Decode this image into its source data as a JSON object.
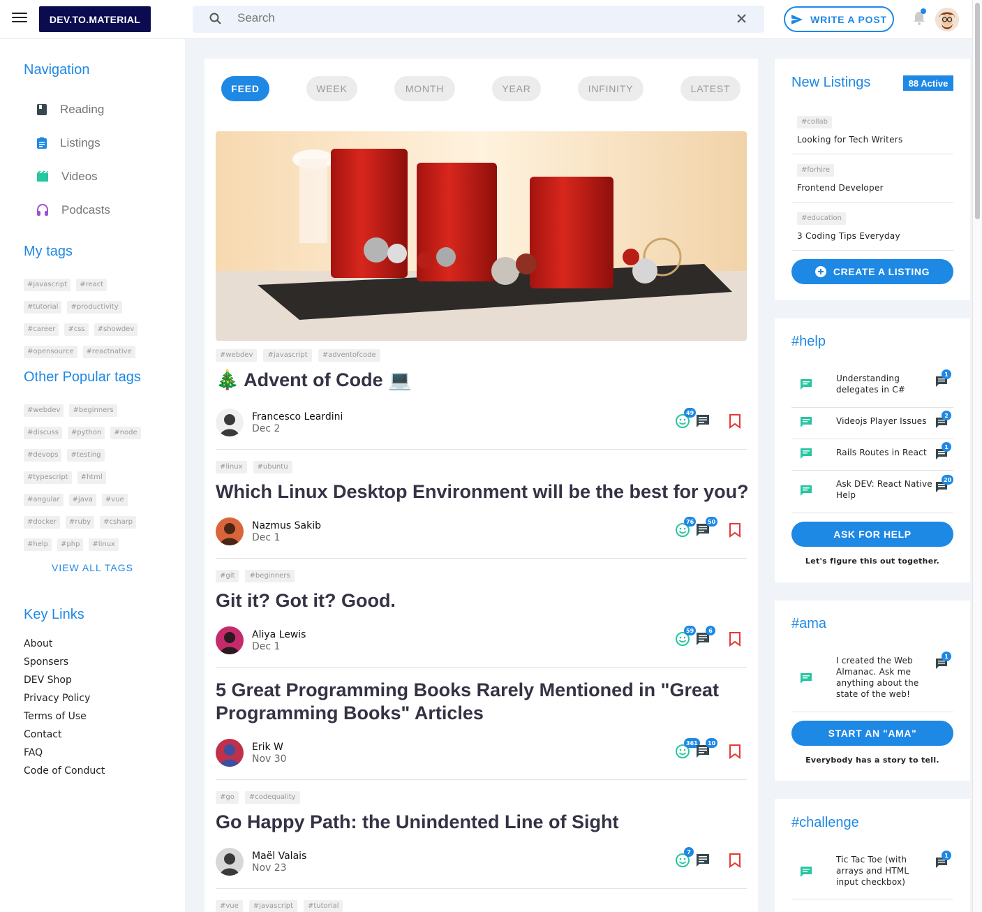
{
  "header": {
    "logo": "DEV.TO.MATERIAL",
    "search_placeholder": "Search",
    "write_label": "WRITE A POST"
  },
  "sidebar": {
    "nav_title": "Navigation",
    "nav_items": [
      {
        "label": "Reading",
        "icon": "book-icon",
        "color": "#37474f"
      },
      {
        "label": "Listings",
        "icon": "clipboard-icon",
        "color": "#1e88e5"
      },
      {
        "label": "Videos",
        "icon": "movie-icon",
        "color": "#26c6a0"
      },
      {
        "label": "Podcasts",
        "icon": "headphones-icon",
        "color": "#9c4fd6"
      }
    ],
    "my_tags_title": "My tags",
    "my_tags": [
      "#javascript",
      "#react",
      "#tutorial",
      "#productivity",
      "#career",
      "#css",
      "#showdev",
      "#opensource",
      "#reactnative"
    ],
    "popular_title": "Other Popular tags",
    "popular_tags": [
      "#webdev",
      "#beginners",
      "#discuss",
      "#python",
      "#node",
      "#devops",
      "#testing",
      "#typescript",
      "#html",
      "#angular",
      "#java",
      "#vue",
      "#docker",
      "#ruby",
      "#csharp",
      "#help",
      "#php",
      "#linux"
    ],
    "view_all": "VIEW ALL TAGS",
    "key_links_title": "Key Links",
    "key_links": [
      "About",
      "Sponsers",
      "DEV Shop",
      "Privacy Policy",
      "Terms of Use",
      "Contact",
      "FAQ",
      "Code of Conduct"
    ]
  },
  "tabs": [
    "FEED",
    "WEEK",
    "MONTH",
    "YEAR",
    "INFINITY",
    "LATEST"
  ],
  "posts": [
    {
      "tags": [
        "#webdev",
        "#javascript",
        "#adventofcode"
      ],
      "title": "🎄 Advent of Code 💻",
      "author": "Francesco Leardini",
      "date": "Dec  2",
      "reactions": "49",
      "comments": ""
    },
    {
      "tags": [
        "#linux",
        "#ubuntu"
      ],
      "title": "Which Linux Desktop Environment will be the best for you?",
      "author": "Nazmus Sakib",
      "date": "Dec  1",
      "reactions": "76",
      "comments": "50"
    },
    {
      "tags": [
        "#git",
        "#beginners"
      ],
      "title": "Git it? Got it? Good.",
      "author": "Aliya Lewis",
      "date": "Dec  1",
      "reactions": "59",
      "comments": "6"
    },
    {
      "tags": [],
      "title": "5 Great Programming Books Rarely Mentioned in \"Great Programming Books\" Articles",
      "author": "Erik W",
      "date": "Nov 30",
      "reactions": "361",
      "comments": "10"
    },
    {
      "tags": [
        "#go",
        "#codequality"
      ],
      "title": "Go Happy Path: the Unindented Line of Sight",
      "author": "Maël Valais",
      "date": "Nov 23",
      "reactions": "7",
      "comments": ""
    },
    {
      "tags": [
        "#vue",
        "#javascript",
        "#tutorial"
      ],
      "title": "",
      "author": "",
      "date": "",
      "reactions": "",
      "comments": ""
    }
  ],
  "listings": {
    "title": "New Listings",
    "active_badge": "88 Active",
    "items": [
      {
        "tag": "#collab",
        "title": "Looking for Tech Writers"
      },
      {
        "tag": "#forhire",
        "title": "Frontend Developer"
      },
      {
        "tag": "#education",
        "title": "3 Coding Tips Everyday"
      }
    ],
    "create_label": "CREATE A LISTING"
  },
  "help": {
    "title": "#help",
    "threads": [
      {
        "text": "Understanding delegates in C#",
        "count": "1"
      },
      {
        "text": "Videojs Player Issues",
        "count": "2"
      },
      {
        "text": "Rails Routes in React",
        "count": "1"
      },
      {
        "text": "Ask DEV: React Native Help",
        "count": "20"
      }
    ],
    "button": "ASK FOR HELP",
    "subtext": "Let's figure this out together."
  },
  "ama": {
    "title": "#ama",
    "threads": [
      {
        "text": "I created the Web Almanac. Ask me anything about the state of the web!",
        "count": "1"
      }
    ],
    "button": "START AN \"AMA\"",
    "subtext": "Everybody has a story to tell."
  },
  "challenge": {
    "title": "#challenge",
    "threads": [
      {
        "text": "Tic Tac Toe (with arrays and HTML input checkbox)",
        "count": "1"
      }
    ]
  },
  "colors": {
    "accent": "#1e88e5",
    "teal": "#26c6a0",
    "logo_bg": "#0b0b50",
    "bookmark": "#e53935"
  }
}
